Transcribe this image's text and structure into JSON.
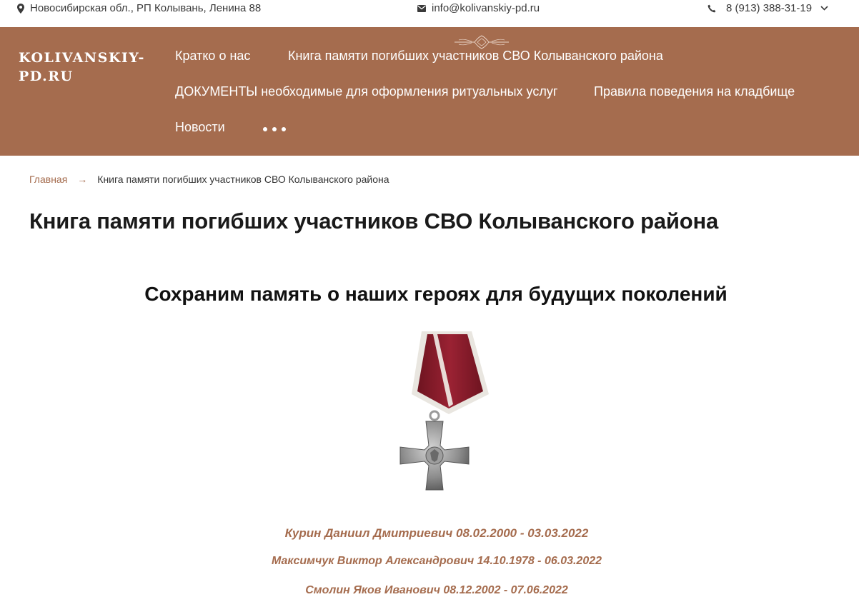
{
  "topbar": {
    "address": "Новосибирская обл., РП Колывань, Ленина 88",
    "email": "info@kolivanskiy-pd.ru",
    "phone": "8 (913) 388-31-19",
    "icons": [
      "map-pin-icon",
      "envelope-icon",
      "phone-icon",
      "chevron-down-icon"
    ]
  },
  "header": {
    "logo": "KOLIVANSKIY-PD.RU",
    "nav": [
      "Кратко о нас",
      "Книга памяти погибших участников СВО Колыванского района",
      "ДОКУМЕНТЫ необходимые для оформления ритуальных услуг",
      "Правила поведения на кладбище",
      "Новости"
    ],
    "background": "#a56c4e"
  },
  "breadcrumb": {
    "home": "Главная",
    "separator": "→",
    "current": "Книга памяти погибших участников СВО Колыванского района"
  },
  "page": {
    "title": "Книга памяти погибших участников СВО Колыванского района",
    "subtitle": "Сохраним память о наших героях для будущих поколений",
    "heroes": [
      "Курин Даниил Дмитриевич 08.02.2000 - 03.03.2022",
      "Максимчук Виктор Александрович 14.10.1978 - 06.03.2022",
      "Смолин Яков Иванович 08.12.2002 - 07.06.2022"
    ]
  },
  "colors": {
    "accent": "#a56c4e",
    "ribbon": "#8e1b2a"
  }
}
